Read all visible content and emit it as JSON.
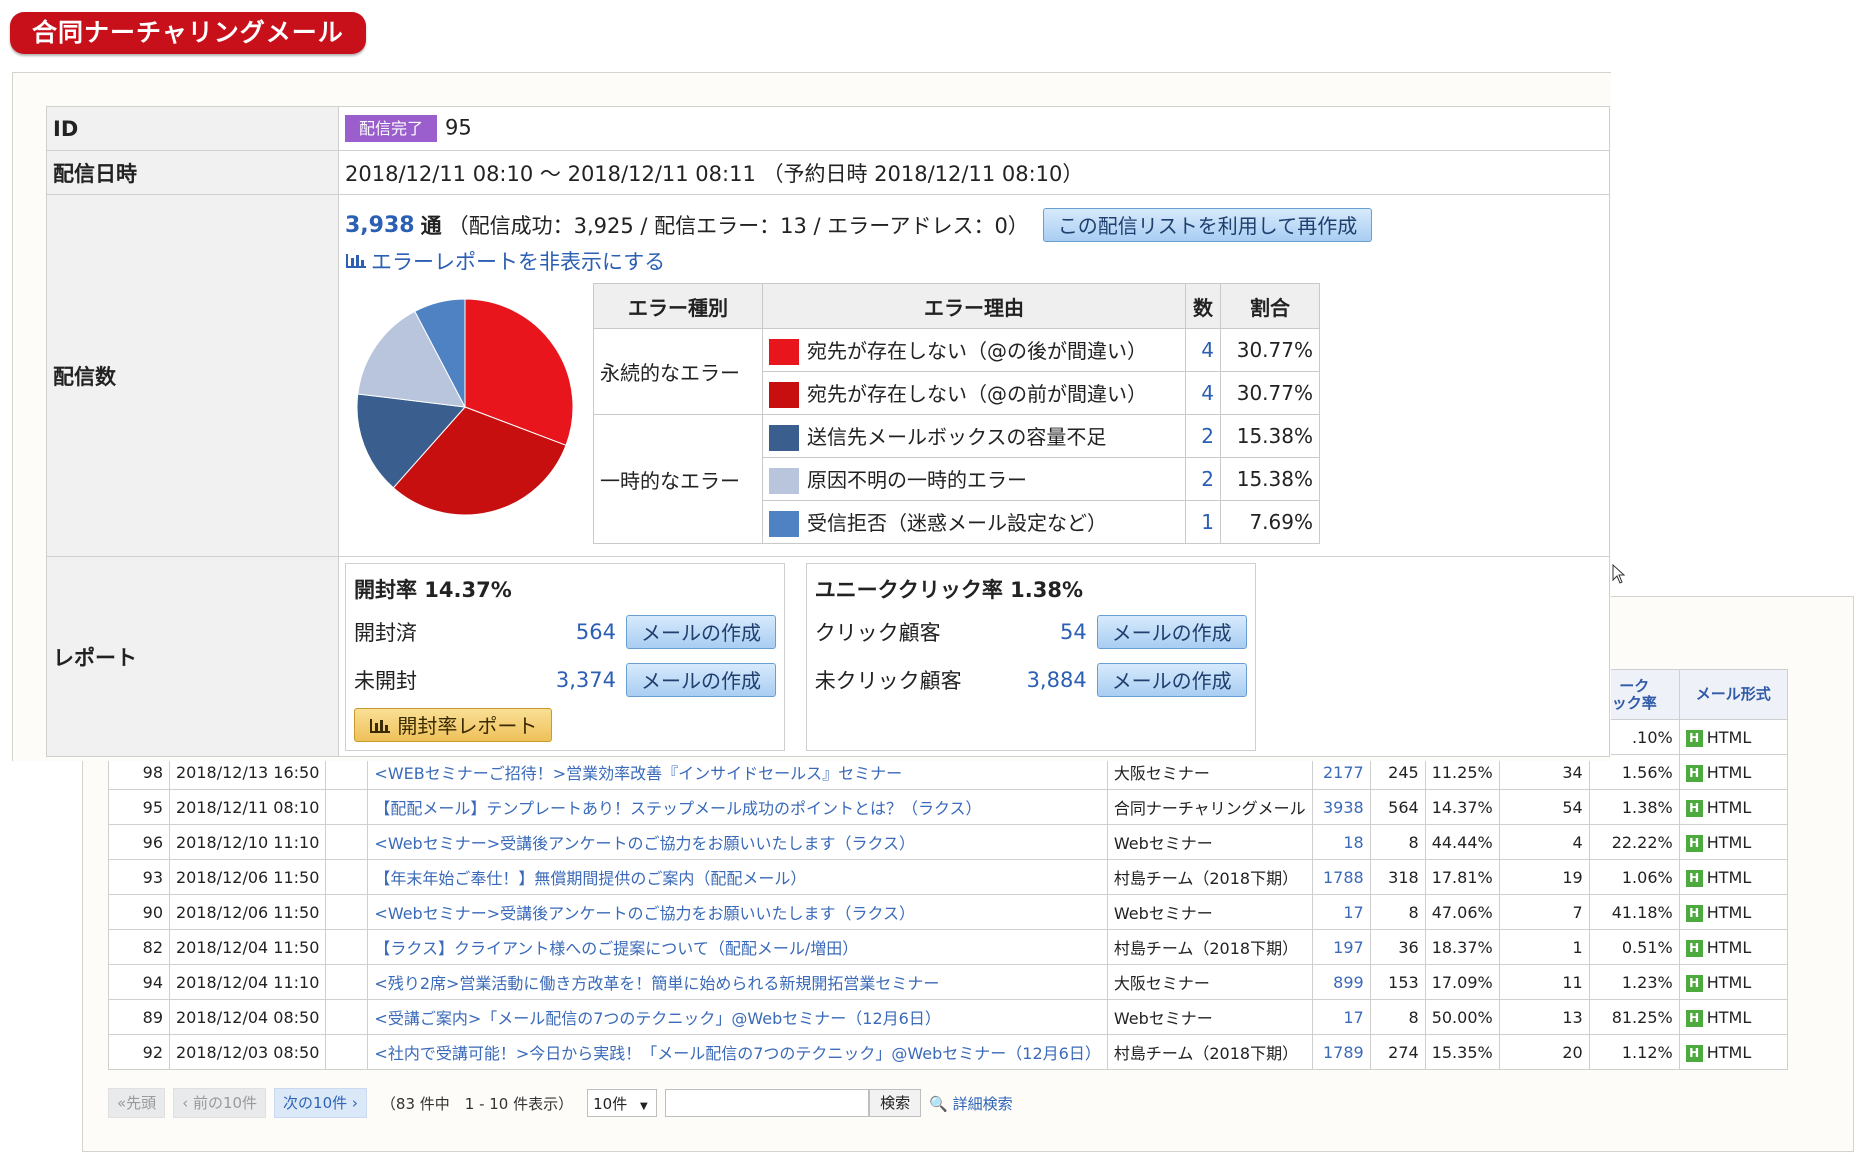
{
  "app_title": "合同ナーチャリングメール",
  "detail": {
    "id_label": "ID",
    "status": "配信完了",
    "id_value": "95",
    "date_label": "配信日時",
    "date_value": "2018/12/11 08:10 ～ 2018/12/11 08:11 （予約日時 2018/12/11 08:10）",
    "count_label": "配信数",
    "count_total": "3,938",
    "count_unit": "通",
    "count_breakdown": "（配信成功：3,925 / 配信エラー：13 / エラーアドレス：0）",
    "recreate_button": "この配信リストを利用して再作成",
    "hide_error_report": "エラーレポートを非表示にする",
    "report_label": "レポート"
  },
  "error_table": {
    "headers": [
      "エラー種別",
      "エラー理由",
      "数",
      "割合"
    ],
    "groups": [
      "永続的なエラー",
      "一時的なエラー"
    ],
    "rows": [
      {
        "reason": "宛先が存在しない（@の後が間違い）",
        "count": "4",
        "ratio": "30.77%",
        "color": "#e8151c"
      },
      {
        "reason": "宛先が存在しない（@の前が間違い）",
        "count": "4",
        "ratio": "30.77%",
        "color": "#c70f10"
      },
      {
        "reason": "送信先メールボックスの容量不足",
        "count": "2",
        "ratio": "15.38%",
        "color": "#3a5f8f"
      },
      {
        "reason": "原因不明の一時的エラー",
        "count": "2",
        "ratio": "15.38%",
        "color": "#b9c5dd"
      },
      {
        "reason": "受信拒否（迷惑メール設定など）",
        "count": "1",
        "ratio": "7.69%",
        "color": "#4f82c2"
      }
    ]
  },
  "chart_data": {
    "type": "pie",
    "categories": [
      "宛先が存在しない（@の後が間違い）",
      "宛先が存在しない（@の前が間違い）",
      "送信先メールボックスの容量不足",
      "原因不明の一時的エラー",
      "受信拒否（迷惑メール設定など）"
    ],
    "values": [
      30.77,
      30.77,
      15.38,
      15.38,
      7.69
    ],
    "colors": [
      "#e8151c",
      "#c70f10",
      "#3a5f8f",
      "#b9c5dd",
      "#4f82c2"
    ]
  },
  "open_report": {
    "title": "開封率 14.37%",
    "opened_label": "開封済",
    "opened_value": "564",
    "unopened_label": "未開封",
    "unopened_value": "3,374",
    "create_mail": "メールの作成",
    "report_button": "開封率レポート"
  },
  "click_report": {
    "title": "ユニーククリック率 1.38%",
    "clicked_label": "クリック顧客",
    "clicked_value": "54",
    "unclicked_label": "未クリック顧客",
    "unclicked_value": "3,884",
    "create_mail": "メールの作成"
  },
  "list": {
    "headers": {
      "uclick": "ーク\nック率",
      "format": "メール形式"
    },
    "partial_row": {
      "uclick_rate": ".10%",
      "format": "HTML"
    },
    "rows": [
      {
        "id": "98",
        "date": "2018/12/13 16:50",
        "subject": "<WEBセミナーご招待！>営業効率改善『インサイドセールス』セミナー",
        "team": "大阪セミナー",
        "sent": "2177",
        "opened": "245",
        "open_rate": "11.25%",
        "clicks": "34",
        "click_rate": "1.56%",
        "format": "HTML"
      },
      {
        "id": "95",
        "date": "2018/12/11 08:10",
        "subject": "【配配メール】テンプレートあり！ステップメール成功のポイントとは？（ラクス）",
        "team": "合同ナーチャリングメール",
        "sent": "3938",
        "opened": "564",
        "open_rate": "14.37%",
        "clicks": "54",
        "click_rate": "1.38%",
        "format": "HTML"
      },
      {
        "id": "96",
        "date": "2018/12/10 11:10",
        "subject": "<Webセミナー>受講後アンケートのご協力をお願いいたします（ラクス）",
        "team": "Webセミナー",
        "sent": "18",
        "opened": "8",
        "open_rate": "44.44%",
        "clicks": "4",
        "click_rate": "22.22%",
        "format": "HTML"
      },
      {
        "id": "93",
        "date": "2018/12/06 11:50",
        "subject": "【年末年始ご奉仕！】無償期間提供のご案内（配配メール）",
        "team": "村島チーム（2018下期）",
        "sent": "1788",
        "opened": "318",
        "open_rate": "17.81%",
        "clicks": "19",
        "click_rate": "1.06%",
        "format": "HTML"
      },
      {
        "id": "90",
        "date": "2018/12/06 11:50",
        "subject": "<Webセミナー>受講後アンケートのご協力をお願いいたします（ラクス）",
        "team": "Webセミナー",
        "sent": "17",
        "opened": "8",
        "open_rate": "47.06%",
        "clicks": "7",
        "click_rate": "41.18%",
        "format": "HTML"
      },
      {
        "id": "82",
        "date": "2018/12/04 11:50",
        "subject": "【ラクス】クライアント様へのご提案について（配配メール/増田）",
        "team": "村島チーム（2018下期）",
        "sent": "197",
        "opened": "36",
        "open_rate": "18.37%",
        "clicks": "1",
        "click_rate": "0.51%",
        "format": "HTML"
      },
      {
        "id": "94",
        "date": "2018/12/04 11:10",
        "subject": "<残り2席>営業活動に働き方改革を！簡単に始められる新規開拓営業セミナー",
        "team": "大阪セミナー",
        "sent": "899",
        "opened": "153",
        "open_rate": "17.09%",
        "clicks": "11",
        "click_rate": "1.23%",
        "format": "HTML"
      },
      {
        "id": "89",
        "date": "2018/12/04 08:50",
        "subject": "<受講ご案内>「メール配信の7つのテクニック」@Webセミナー（12月6日）",
        "team": "Webセミナー",
        "sent": "17",
        "opened": "8",
        "open_rate": "50.00%",
        "clicks": "13",
        "click_rate": "81.25%",
        "format": "HTML"
      },
      {
        "id": "92",
        "date": "2018/12/03 08:50",
        "subject": "<社内で受講可能！>今日から実践！「メール配信の7つのテクニック」@Webセミナー（12月6日）",
        "team": "村島チーム（2018下期）",
        "sent": "1789",
        "opened": "274",
        "open_rate": "15.35%",
        "clicks": "20",
        "click_rate": "1.12%",
        "format": "HTML"
      }
    ]
  },
  "pager": {
    "first": "«先頭",
    "prev": "‹ 前の10件",
    "next": "次の10件 ›",
    "info": "（83 件中　1 - 10 件表示）",
    "per_page": "10件",
    "search_button": "検索",
    "advanced_search": "詳細検索"
  }
}
